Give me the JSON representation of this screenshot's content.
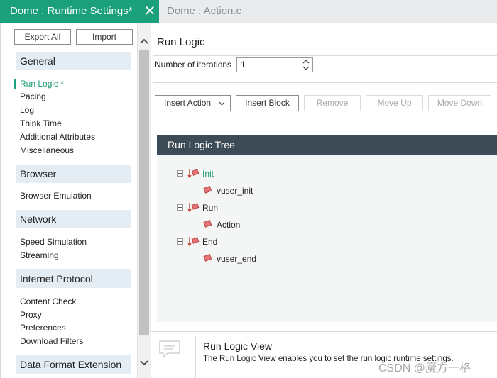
{
  "tabs": [
    {
      "label": "Dome : Runtime Settings*",
      "close_icon": "close-icon"
    },
    {
      "label": "Dome : Action.c"
    }
  ],
  "sidebar": {
    "export_label": "Export All",
    "import_label": "Import",
    "sections": [
      {
        "title": "General",
        "items": [
          "Run Logic *",
          "Pacing",
          "Log",
          "Think Time",
          "Additional Attributes",
          "Miscellaneous"
        ]
      },
      {
        "title": "Browser",
        "items": [
          "Browser Emulation"
        ]
      },
      {
        "title": "Network",
        "items": [
          "Speed Simulation",
          "Streaming"
        ]
      },
      {
        "title": "Internet Protocol",
        "items": [
          "Content Check",
          "Proxy",
          "Preferences",
          "Download Filters"
        ]
      },
      {
        "title": "Data Format Extension",
        "items": []
      }
    ],
    "active_item": "Run Logic *"
  },
  "main": {
    "title": "Run Logic",
    "iterations_label": "Number of iterations",
    "iterations_value": "1",
    "toolbar": {
      "insert_action": "Insert Action",
      "insert_block": "Insert Block",
      "remove": "Remove",
      "move_up": "Move Up",
      "move_down": "Move Down"
    },
    "tree": {
      "title": "Run Logic Tree",
      "nodes": [
        {
          "label": "Init",
          "children": [
            "vuser_init"
          ]
        },
        {
          "label": "Run",
          "children": [
            "Action"
          ]
        },
        {
          "label": "End",
          "children": [
            "vuser_end"
          ]
        }
      ]
    },
    "help": {
      "title": "Run Logic View",
      "text": "The Run Logic View enables you to set the run logic runtime settings."
    }
  },
  "watermark": "CSDN @魔方一格",
  "colors": {
    "accent": "#1aa07a",
    "tree_header": "#3c4b56",
    "section_bg": "#e4edf4"
  }
}
